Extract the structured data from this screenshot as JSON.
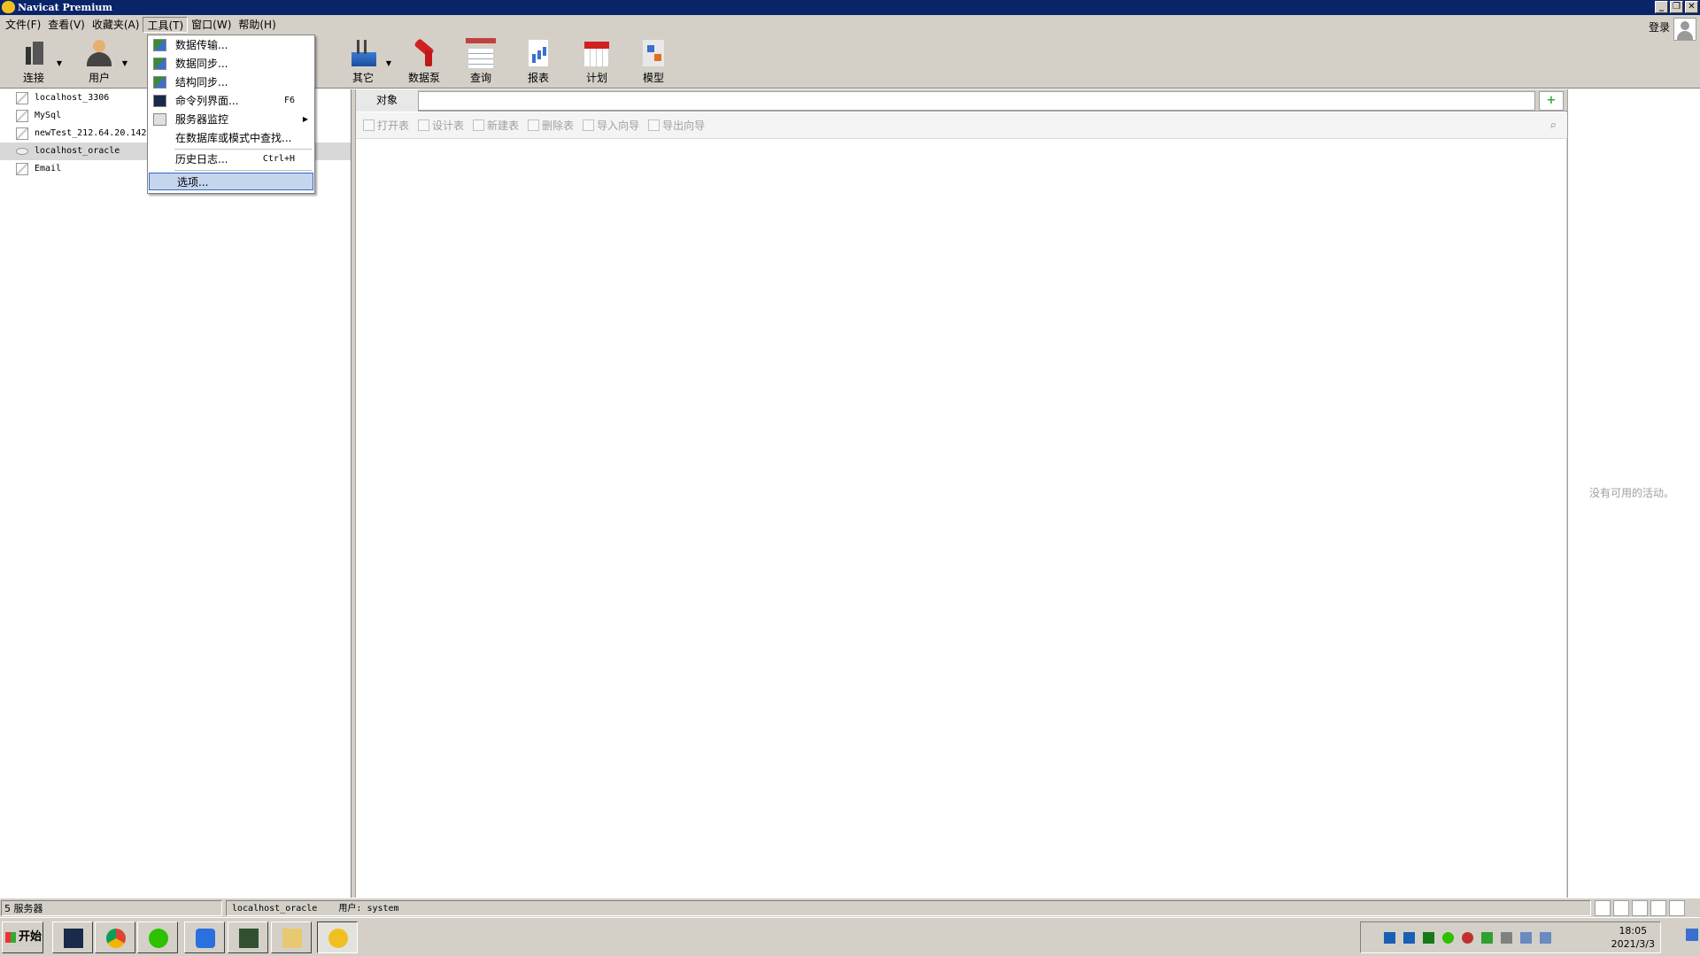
{
  "window": {
    "title": "Navicat Premium"
  },
  "menubar": [
    "文件(F)",
    "查看(V)",
    "收藏夹(A)",
    "工具(T)",
    "窗口(W)",
    "帮助(H)"
  ],
  "header": {
    "login": "登录"
  },
  "toolbar": {
    "connect": "连接",
    "user": "用户",
    "other": "其它",
    "pump": "数据泵",
    "query": "查询",
    "report": "报表",
    "plan": "计划",
    "model": "模型"
  },
  "tools_menu": {
    "items": [
      {
        "label": "数据传输...",
        "shortcut": ""
      },
      {
        "label": "数据同步...",
        "shortcut": ""
      },
      {
        "label": "结构同步...",
        "shortcut": ""
      },
      {
        "label": "命令列界面...",
        "shortcut": "F6"
      },
      {
        "label": "服务器监控",
        "shortcut": ""
      },
      {
        "label": "在数据库或模式中查找...",
        "shortcut": ""
      },
      {
        "label": "历史日志...",
        "shortcut": "Ctrl+H"
      },
      {
        "label": "选项...",
        "shortcut": ""
      }
    ]
  },
  "connections": [
    "localhost_3306",
    "MySql",
    "newTest_212.64.20.142",
    "localhost_oracle",
    "Email"
  ],
  "main": {
    "tab": "对象",
    "object_toolbar": [
      "打开表",
      "设计表",
      "新建表",
      "删除表",
      "导入向导",
      "导出向导"
    ]
  },
  "right_panel": {
    "message": "没有可用的活动。"
  },
  "statusbar": {
    "servers": "5 服务器",
    "connection": "localhost_oracle    用户: system"
  },
  "taskbar": {
    "start": "开始",
    "time": "18:05",
    "date": "2021/3/3"
  }
}
